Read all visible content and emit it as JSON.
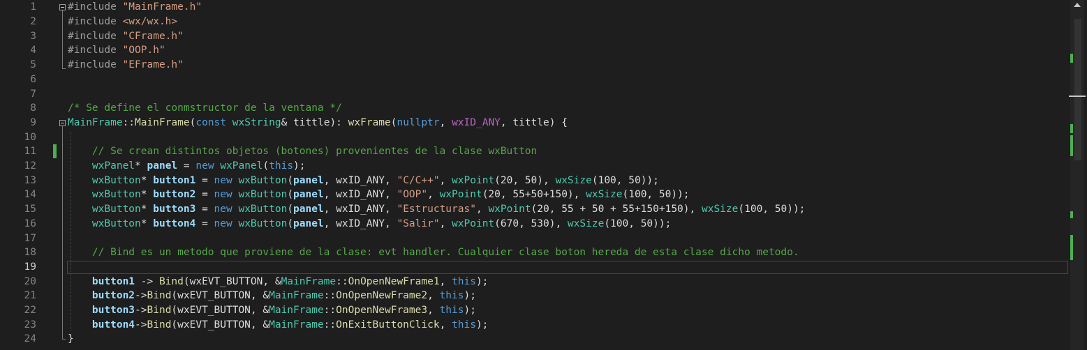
{
  "editor": {
    "current_line": 19,
    "line_numbers": [
      "1",
      "2",
      "3",
      "4",
      "5",
      "6",
      "7",
      "8",
      "9",
      "10",
      "11",
      "12",
      "13",
      "14",
      "15",
      "16",
      "17",
      "18",
      "19",
      "20",
      "21",
      "22",
      "23",
      "24"
    ],
    "lines": [
      [
        [
          "pp",
          "#include "
        ],
        [
          "str",
          "\"MainFrame.h\""
        ]
      ],
      [
        [
          "pp",
          "#include "
        ],
        [
          "str",
          "<wx/wx.h>"
        ]
      ],
      [
        [
          "pp",
          "#include "
        ],
        [
          "str",
          "\"CFrame.h\""
        ]
      ],
      [
        [
          "pp",
          "#include "
        ],
        [
          "str",
          "\"OOP.h\""
        ]
      ],
      [
        [
          "pp",
          "#include "
        ],
        [
          "str",
          "\"EFrame.h\""
        ]
      ],
      [],
      [],
      [
        [
          "cmt",
          "/* Se define el conmstructor de la ventana */"
        ]
      ],
      [
        [
          "type",
          "MainFrame"
        ],
        [
          "",
          "::"
        ],
        [
          "fn",
          "MainFrame"
        ],
        [
          "",
          "("
        ],
        [
          "kw",
          "const "
        ],
        [
          "type",
          "wxString"
        ],
        [
          "",
          "& "
        ],
        [
          "",
          "tittle"
        ],
        [
          "",
          "): "
        ],
        [
          "fn",
          "wxFrame"
        ],
        [
          "",
          "("
        ],
        [
          "kw",
          "nullptr"
        ],
        [
          "",
          ", "
        ],
        [
          "mac",
          "wxID_ANY"
        ],
        [
          "",
          ", tittle) {"
        ]
      ],
      [],
      [
        [
          "",
          "    "
        ],
        [
          "cmt",
          "// Se crean distintos objetos (botones) provenientes de la clase wxButton"
        ]
      ],
      [
        [
          "",
          "    "
        ],
        [
          "type",
          "wxPanel"
        ],
        [
          "",
          "* "
        ],
        [
          "var",
          "panel"
        ],
        [
          "",
          " = "
        ],
        [
          "kw",
          "new "
        ],
        [
          "type",
          "wxPanel"
        ],
        [
          "",
          "("
        ],
        [
          "kw",
          "this"
        ],
        [
          "",
          ");"
        ]
      ],
      [
        [
          "",
          "    "
        ],
        [
          "type",
          "wxButton"
        ],
        [
          "",
          "* "
        ],
        [
          "var",
          "button1"
        ],
        [
          "",
          " = "
        ],
        [
          "kw",
          "new "
        ],
        [
          "type",
          "wxButton"
        ],
        [
          "",
          "("
        ],
        [
          "var",
          "panel"
        ],
        [
          "",
          ", wxID_ANY, "
        ],
        [
          "str",
          "\"C/C++\""
        ],
        [
          "",
          ", "
        ],
        [
          "type",
          "wxPoint"
        ],
        [
          "",
          "(20, 50), "
        ],
        [
          "type",
          "wxSize"
        ],
        [
          "",
          "(100, 50));"
        ]
      ],
      [
        [
          "",
          "    "
        ],
        [
          "type",
          "wxButton"
        ],
        [
          "",
          "* "
        ],
        [
          "var",
          "button2"
        ],
        [
          "",
          " = "
        ],
        [
          "kw",
          "new "
        ],
        [
          "type",
          "wxButton"
        ],
        [
          "",
          "("
        ],
        [
          "var",
          "panel"
        ],
        [
          "",
          ", wxID_ANY, "
        ],
        [
          "str",
          "\"OOP\""
        ],
        [
          "",
          ", "
        ],
        [
          "type",
          "wxPoint"
        ],
        [
          "",
          "(20, 55+50+150), "
        ],
        [
          "type",
          "wxSize"
        ],
        [
          "",
          "(100, 50));"
        ]
      ],
      [
        [
          "",
          "    "
        ],
        [
          "type",
          "wxButton"
        ],
        [
          "",
          "* "
        ],
        [
          "var",
          "button3"
        ],
        [
          "",
          " = "
        ],
        [
          "kw",
          "new "
        ],
        [
          "type",
          "wxButton"
        ],
        [
          "",
          "("
        ],
        [
          "var",
          "panel"
        ],
        [
          "",
          ", wxID_ANY, "
        ],
        [
          "str",
          "\"Estructuras\""
        ],
        [
          "",
          ", "
        ],
        [
          "type",
          "wxPoint"
        ],
        [
          "",
          "(20, 55 + 50 + 55+150+150), "
        ],
        [
          "type",
          "wxSize"
        ],
        [
          "",
          "(100, 50));"
        ]
      ],
      [
        [
          "",
          "    "
        ],
        [
          "type",
          "wxButton"
        ],
        [
          "",
          "* "
        ],
        [
          "var",
          "button4"
        ],
        [
          "",
          " = "
        ],
        [
          "kw",
          "new "
        ],
        [
          "type",
          "wxButton"
        ],
        [
          "",
          "("
        ],
        [
          "var",
          "panel"
        ],
        [
          "",
          ", wxID_ANY, "
        ],
        [
          "str",
          "\"Salir\""
        ],
        [
          "",
          ", "
        ],
        [
          "type",
          "wxPoint"
        ],
        [
          "",
          "(670, 530), "
        ],
        [
          "type",
          "wxSize"
        ],
        [
          "",
          "(100, 50));"
        ]
      ],
      [],
      [
        [
          "",
          "    "
        ],
        [
          "cmt",
          "// Bind es un metodo que proviene de la clase: evt handler. Cualquier clase boton hereda de esta clase dicho metodo."
        ]
      ],
      [],
      [
        [
          "",
          "    "
        ],
        [
          "var",
          "button1"
        ],
        [
          "",
          " -> "
        ],
        [
          "fn",
          "Bind"
        ],
        [
          "",
          "(wxEVT_BUTTON, &"
        ],
        [
          "type",
          "MainFrame"
        ],
        [
          "",
          "::"
        ],
        [
          "fn",
          "OnOpenNewFrame1"
        ],
        [
          "",
          ", "
        ],
        [
          "kw",
          "this"
        ],
        [
          "",
          ");"
        ]
      ],
      [
        [
          "",
          "    "
        ],
        [
          "var",
          "button2"
        ],
        [
          "",
          "->"
        ],
        [
          "fn",
          "Bind"
        ],
        [
          "",
          "(wxEVT_BUTTON, &"
        ],
        [
          "type",
          "MainFrame"
        ],
        [
          "",
          "::"
        ],
        [
          "fn",
          "OnOpenNewFrame2"
        ],
        [
          "",
          ", "
        ],
        [
          "kw",
          "this"
        ],
        [
          "",
          ");"
        ]
      ],
      [
        [
          "",
          "    "
        ],
        [
          "var",
          "button3"
        ],
        [
          "",
          "->"
        ],
        [
          "fn",
          "Bind"
        ],
        [
          "",
          "(wxEVT_BUTTON, &"
        ],
        [
          "type",
          "MainFrame"
        ],
        [
          "",
          "::"
        ],
        [
          "fn",
          "OnOpenNewFrame3"
        ],
        [
          "",
          ", "
        ],
        [
          "kw",
          "this"
        ],
        [
          "",
          ");"
        ]
      ],
      [
        [
          "",
          "    "
        ],
        [
          "var",
          "button4"
        ],
        [
          "",
          "->"
        ],
        [
          "fn",
          "Bind"
        ],
        [
          "",
          "(wxEVT_BUTTON, &"
        ],
        [
          "type",
          "MainFrame"
        ],
        [
          "",
          "::"
        ],
        [
          "fn",
          "OnExitButtonClick"
        ],
        [
          "",
          ", "
        ],
        [
          "kw",
          "this"
        ],
        [
          "",
          ");"
        ]
      ],
      [
        [
          "",
          "}"
        ]
      ]
    ],
    "colors": {
      "background": "#1e1e1e",
      "line_number": "#858585",
      "keyword": "#569cd6",
      "type": "#4ec9b0",
      "function": "#dcdcaa",
      "string": "#d69d85",
      "comment": "#57a64a",
      "preprocessor": "#9b9b9b",
      "variable": "#9cdcfe",
      "macro": "#bd63c5",
      "change_marker": "#4caf50"
    },
    "icons": [
      "fold-collapse-icon",
      "scroll-up-arrow-icon"
    ]
  }
}
